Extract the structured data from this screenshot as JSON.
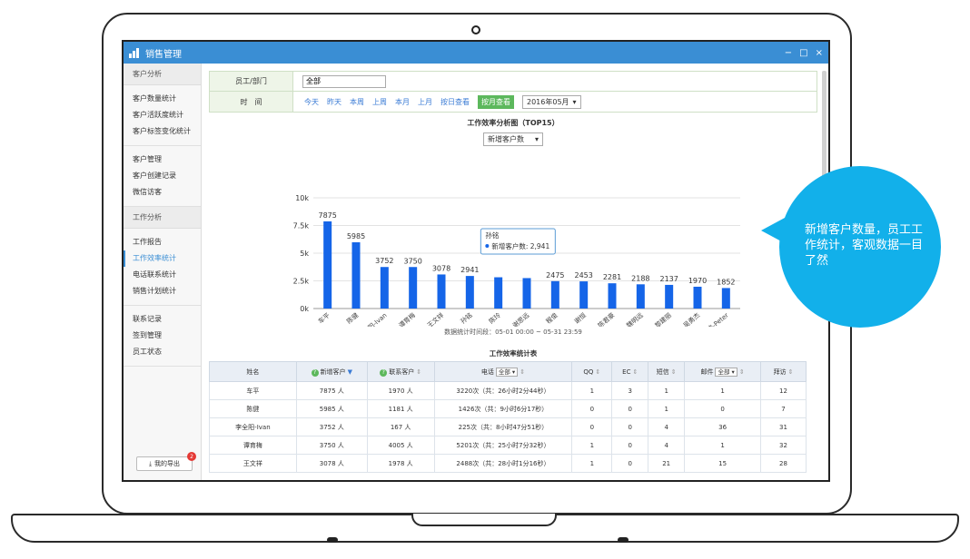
{
  "window": {
    "title": "销售管理",
    "controls": [
      "−",
      "□",
      "×"
    ]
  },
  "sidebar": {
    "groups": [
      {
        "header": "客户分析",
        "items": [
          "客户数量统计",
          "客户活跃度统计",
          "客户标签变化统计"
        ]
      },
      {
        "header": "",
        "items": [
          "客户管理",
          "客户创建记录",
          "微信访客"
        ]
      },
      {
        "header": "工作分析",
        "items": [
          "工作报告",
          "工作效率统计",
          "电话联系统计",
          "销售计划统计"
        ]
      },
      {
        "header": "",
        "items": [
          "联系记录",
          "签到管理",
          "员工状态"
        ]
      }
    ],
    "active_item": "工作效率统计",
    "export_label": "我的导出",
    "export_badge": "2"
  },
  "filter": {
    "dept_label": "员工/部门",
    "dept_value": "全部",
    "time_label": "时　间",
    "time_links": [
      "今天",
      "昨天",
      "本周",
      "上周",
      "本月",
      "上月",
      "按日查看",
      "按月查看"
    ],
    "active_time": "按月查看",
    "month_value": "2016年05月"
  },
  "chart": {
    "title": "工作效率分析图（TOP15）",
    "metric_select": "新增客户数",
    "tooltip_name": "孙铭",
    "tooltip_label": "新增客户数",
    "tooltip_value": "2,941",
    "range_text": "数据统计时间段：05-01 00:00 ~ 05-31 23:59"
  },
  "chart_data": {
    "type": "bar",
    "categories": [
      "车平",
      "陈健",
      "李全阳-Ivan",
      "谭育梅",
      "王文祥",
      "孙铭",
      "陈玲",
      "谢思远",
      "程俊",
      "谢恒",
      "陈君豪",
      "魏明远",
      "黎建丽",
      "吴勇杰",
      "程锦涛-Peter"
    ],
    "values": [
      7875,
      5985,
      3752,
      3750,
      3078,
      2941,
      2824,
      2750,
      2475,
      2453,
      2281,
      2188,
      2137,
      1970,
      1852
    ],
    "labels": [
      "7875",
      "5985",
      "3752",
      "3750",
      "3078",
      "2941",
      "",
      "",
      "2475",
      "2453",
      "2281",
      "2188",
      "2137",
      "1970",
      "1852"
    ],
    "yticks": [
      "0k",
      "2.5k",
      "5k",
      "7.5k",
      "10k"
    ],
    "ylim": [
      0,
      10000
    ],
    "color": "#1565e8",
    "grid": true
  },
  "table": {
    "title": "工作效率统计表",
    "headers": {
      "name": "姓名",
      "new": "新增客户",
      "contact": "联系客户",
      "phone": "电话",
      "phone_sel": "全部",
      "qq": "QQ",
      "ec": "EC",
      "sms": "短信",
      "mail": "邮件",
      "mail_sel": "全部",
      "visit": "拜访"
    },
    "rows": [
      {
        "name": "车平",
        "new": "7875 人",
        "contact": "1970 人",
        "phone": "3220次（共：26小时2分44秒）",
        "qq": "1",
        "ec": "3",
        "sms": "1",
        "mail": "1",
        "visit": "12"
      },
      {
        "name": "陈健",
        "new": "5985 人",
        "contact": "1181 人",
        "phone": "1426次（共：9小时6分17秒）",
        "qq": "0",
        "ec": "0",
        "sms": "1",
        "mail": "0",
        "visit": "7"
      },
      {
        "name": "李全阳-Ivan",
        "new": "3752 人",
        "contact": "167 人",
        "phone": "225次（共：8小时47分51秒）",
        "qq": "0",
        "ec": "0",
        "sms": "4",
        "mail": "36",
        "visit": "31"
      },
      {
        "name": "谭育梅",
        "new": "3750 人",
        "contact": "4005 人",
        "phone": "5201次（共：25小时7分32秒）",
        "qq": "1",
        "ec": "0",
        "sms": "4",
        "mail": "1",
        "visit": "32"
      },
      {
        "name": "王文祥",
        "new": "3078 人",
        "contact": "1978 人",
        "phone": "2488次（共：28小时1分16秒）",
        "qq": "1",
        "ec": "0",
        "sms": "21",
        "mail": "15",
        "visit": "28"
      }
    ]
  },
  "callout": {
    "text": "新增客户数量，员工工作统计，客观数据一目了然"
  }
}
